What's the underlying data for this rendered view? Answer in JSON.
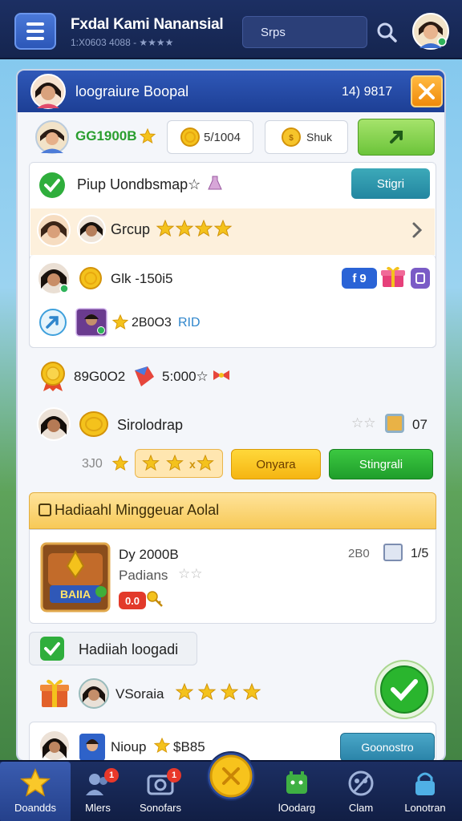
{
  "topbar": {
    "title": "Fxdal Kami Nanansial",
    "subtitle": "1:X0603 4088 - ★★★★",
    "search_text": "Srps"
  },
  "panel": {
    "title": "loograiure Boopal",
    "count": "14) 9817"
  },
  "currency": {
    "gems": "GG1900B",
    "coins": "5/1004",
    "stash": "Shuk"
  },
  "group_section": {
    "title": "Piup Uondbsmap☆",
    "start_label": "Stigri",
    "group_label": "Grcup"
  },
  "card1": {
    "label": "Glk -150i5",
    "badge_count": "9",
    "score": "2B0O3",
    "tag": "RID"
  },
  "reward_row": {
    "amount1": "89G0O2",
    "amount2": "5:000☆"
  },
  "friend_row": {
    "name": "Sirolodrap",
    "count": "07",
    "prefix": "3J0",
    "btn_orange": "Onyara",
    "btn_green": "Stingrali"
  },
  "mission_section": {
    "title": "Hadiaahl Minggeuar Aolal",
    "item_title": "Dy 2000B",
    "item_sub": "Padians",
    "item_tag": "0.0",
    "item_score": "2B0",
    "item_count": "1/5",
    "card_label": "BAIIA"
  },
  "bonus_section": {
    "title": "Hadiiah loogadi",
    "row_label": "VSoraia",
    "footer_name": "Nioup",
    "footer_amount": "$B85",
    "footer_button": "Goonostro"
  },
  "bottom_nav": [
    {
      "label": "Doandds",
      "badge": ""
    },
    {
      "label": "Mlers",
      "badge": "1"
    },
    {
      "label": "Sonofars",
      "badge": "1"
    },
    {
      "label": "",
      "badge": ""
    },
    {
      "label": "lOodarg",
      "badge": ""
    },
    {
      "label": "Clam",
      "badge": ""
    },
    {
      "label": "Lonotran",
      "badge": ""
    }
  ],
  "colors": {
    "header_blue": "#1d3f95",
    "accent_orange": "#f39b1b",
    "accent_green": "#2ab52e",
    "accent_teal": "#2f9cae",
    "gold": "#f4c21c"
  }
}
